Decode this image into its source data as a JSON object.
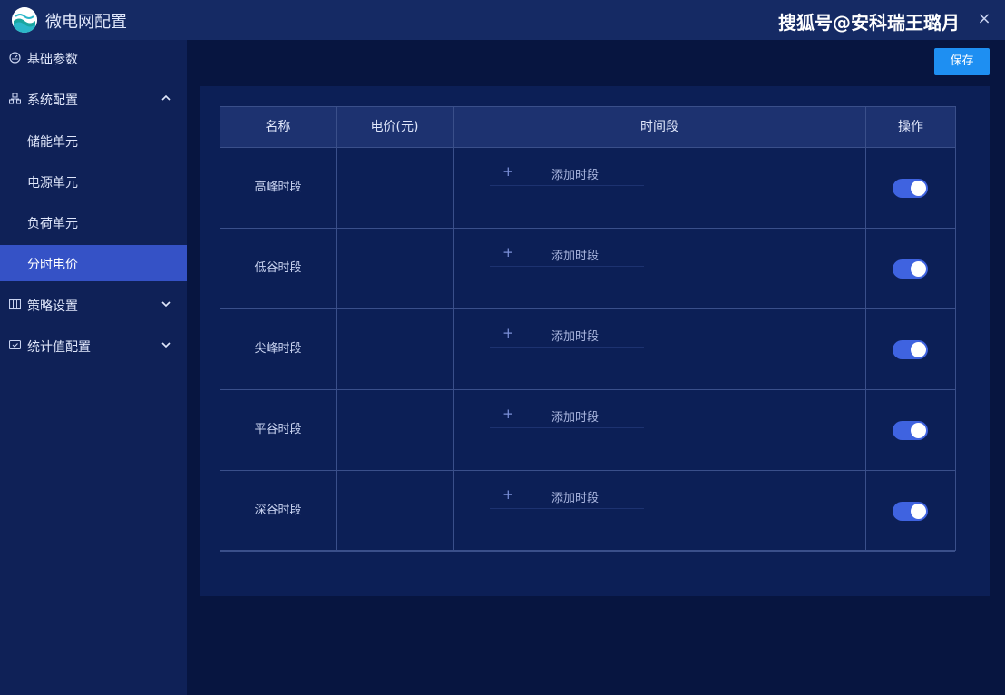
{
  "titlebar": {
    "title": "微电网配置",
    "watermark": "搜狐号@安科瑞王璐月",
    "close": "×"
  },
  "sidebar": {
    "items": [
      {
        "label": "基础参数",
        "icon": "gauge-icon"
      },
      {
        "label": "系统配置",
        "icon": "network-icon",
        "expanded": true
      },
      {
        "label": "储能单元",
        "sub": true
      },
      {
        "label": "电源单元",
        "sub": true
      },
      {
        "label": "负荷单元",
        "sub": true
      },
      {
        "label": "分时电价",
        "sub": true,
        "active": true
      },
      {
        "label": "策略设置",
        "icon": "grid-icon",
        "expanded": false
      },
      {
        "label": "统计值配置",
        "icon": "shield-icon",
        "expanded": false
      }
    ]
  },
  "toolbar": {
    "save_label": "保存"
  },
  "table": {
    "headers": [
      "名称",
      "电价(元)",
      "时间段",
      "操作"
    ],
    "add_label": "添加时段",
    "add_icon": "+",
    "rows": [
      {
        "name": "高峰时段",
        "price": "",
        "enabled": true
      },
      {
        "name": "低谷时段",
        "price": "",
        "enabled": true
      },
      {
        "name": "尖峰时段",
        "price": "",
        "enabled": true
      },
      {
        "name": "平谷时段",
        "price": "",
        "enabled": true
      },
      {
        "name": "深谷时段",
        "price": "",
        "enabled": true
      }
    ]
  },
  "colors": {
    "background": "#071540",
    "sidebar": "#0f2157",
    "titlebar": "#152a64",
    "accent": "#3552c6",
    "save_button": "#1e8ff2",
    "toggle_on": "#3f63e0"
  }
}
